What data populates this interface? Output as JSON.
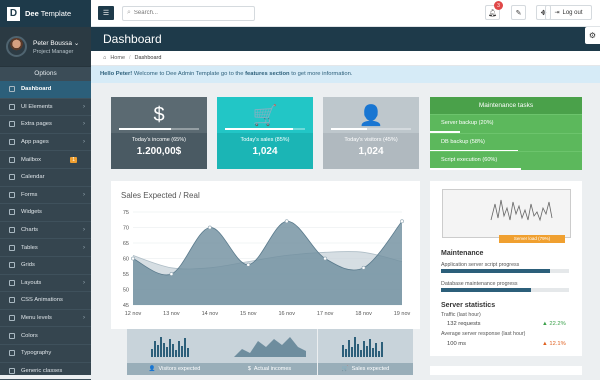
{
  "brand": {
    "logo": "D",
    "name_bold": "Dee",
    "name_rest": " Template"
  },
  "user": {
    "name": "Peter Boussa",
    "role": "Project Manager"
  },
  "sidebar": {
    "options_label": "Options",
    "items": [
      {
        "label": "Dashboard",
        "icon": "dashboard-icon",
        "active": true
      },
      {
        "label": "UI Elements",
        "icon": "ui-icon",
        "arrow": true
      },
      {
        "label": "Extra pages",
        "icon": "pages-icon",
        "arrow": true
      },
      {
        "label": "App pages",
        "icon": "app-icon",
        "arrow": true
      },
      {
        "label": "Mailbox",
        "icon": "mail-icon",
        "badge": "1"
      },
      {
        "label": "Calendar",
        "icon": "calendar-icon"
      },
      {
        "label": "Forms",
        "icon": "forms-icon",
        "arrow": true
      },
      {
        "label": "Widgets",
        "icon": "widgets-icon"
      },
      {
        "label": "Charts",
        "icon": "charts-icon",
        "arrow": true
      },
      {
        "label": "Tables",
        "icon": "tables-icon",
        "arrow": true
      },
      {
        "label": "Grids",
        "icon": "grids-icon"
      },
      {
        "label": "Layouts",
        "icon": "layouts-icon",
        "arrow": true
      },
      {
        "label": "CSS Animations",
        "icon": "animations-icon"
      },
      {
        "label": "Menu levels",
        "icon": "menu-icon",
        "arrow": true
      },
      {
        "label": "Colors",
        "icon": "colors-icon"
      },
      {
        "label": "Typography",
        "icon": "typography-icon"
      },
      {
        "label": "Generic classes",
        "icon": "generic-icon"
      }
    ]
  },
  "topbar": {
    "search_placeholder": "Search...",
    "notif_count": "3",
    "logout_label": "Log out"
  },
  "page": {
    "title": "Dashboard"
  },
  "breadcrumb": {
    "home": "Home",
    "separator": "/",
    "current": "Dashboard"
  },
  "info": {
    "hello": "Hello Peter!",
    "text1": " Welcome to Dee Admin Template go to the ",
    "link": "features section",
    "text2": " to get more information."
  },
  "stats": [
    {
      "icon": "$",
      "label": "Today's income (65%)",
      "value": "1.200,00$",
      "progress": 0.65,
      "bg": "#4a5a63",
      "topbg": "#5b6a72"
    },
    {
      "icon": "🛒",
      "label": "Today's sales (85%)",
      "value": "1,024",
      "progress": 0.85,
      "bg": "#1bb5b5",
      "topbg": "#22c6c6"
    },
    {
      "icon": "👤",
      "label": "Today's visitors (45%)",
      "value": "1,024",
      "progress": 0.45,
      "bg": "#b0b9bf",
      "topbg": "#bec7cc"
    }
  ],
  "maintenance": {
    "title": "Maintenance tasks",
    "tasks": [
      {
        "label": "Server backup (20%)",
        "progress": 0.2
      },
      {
        "label": "DB backup (58%)",
        "progress": 0.58
      },
      {
        "label": "Script execution (60%)",
        "progress": 0.6
      }
    ]
  },
  "sales": {
    "title_main": "Sales",
    "title_sub": " Expected / Real"
  },
  "chart_data": {
    "type": "area",
    "categories": [
      "12 nov",
      "13 nov",
      "14 nov",
      "15 nov",
      "16 nov",
      "17 nov",
      "18 nov",
      "19 nov"
    ],
    "ylim": [
      45,
      75
    ],
    "yticks": [
      45,
      50,
      55,
      60,
      65,
      70,
      75
    ],
    "series": [
      {
        "name": "Expected",
        "values": [
          61,
          57,
          57,
          59,
          61,
          62,
          62,
          59
        ],
        "color": "#c8d3da"
      },
      {
        "name": "Real",
        "values": [
          60,
          55,
          70,
          58,
          72,
          60,
          57,
          72
        ],
        "color": "#6e8d9e"
      }
    ]
  },
  "mini_panels": [
    {
      "label": "Visitors expected",
      "icon": "user-icon",
      "glyph": "👤"
    },
    {
      "label": "Actual incomes",
      "icon": "dollar-icon",
      "glyph": "$"
    },
    {
      "label": "Sales expected",
      "icon": "cart-icon",
      "glyph": "🛒"
    }
  ],
  "server": {
    "load_label": "Server load (79%)",
    "maintenance_title": "Maintenance",
    "script_label": "Application server script progress",
    "script_progress": 0.85,
    "db_label": "Database maintenance progress",
    "db_progress": 0.7,
    "stats_title": "Server statistics",
    "traffic_label": "Traffic (last hour)",
    "traffic_value": "132 requests",
    "traffic_change": "▲ 22.2%",
    "traffic_color": "#3aa04a",
    "response_label": "Average server response (last hour)",
    "response_value": "100 ms",
    "response_change": "▲ 12.1%",
    "response_color": "#e06020"
  }
}
